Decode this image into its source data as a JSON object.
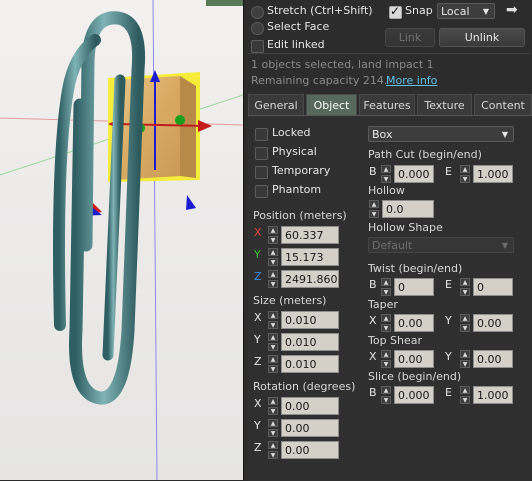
{
  "toolbar": {
    "stretch_label": "Stretch (Ctrl+Shift)",
    "select_face_label": "Select Face",
    "edit_linked_label": "Edit linked",
    "snap_label": "Snap",
    "snap_checked": true,
    "snap_mode": "Local",
    "link_label": "Link",
    "unlink_label": "Unlink",
    "arrow_icon": "arrow-right-icon"
  },
  "status": {
    "selection": "1 objects selected, land impact 1",
    "remaining": "Remaining capacity 214.",
    "more_info": "More info"
  },
  "tabs": [
    "General",
    "Object",
    "Features",
    "Texture",
    "Content"
  ],
  "active_tab": "Object",
  "object": {
    "checkboxes": [
      {
        "label": "Locked",
        "checked": false
      },
      {
        "label": "Physical",
        "checked": false
      },
      {
        "label": "Temporary",
        "checked": false
      },
      {
        "label": "Phantom",
        "checked": false
      }
    ],
    "position_label": "Position (meters)",
    "position": {
      "x": "60.337",
      "y": "15.173",
      "z": "2491.860"
    },
    "size_label": "Size (meters)",
    "size": {
      "x": "0.010",
      "y": "0.010",
      "z": "0.010"
    },
    "rotation_label": "Rotation (degrees)",
    "rotation": {
      "x": "0.00",
      "y": "0.00",
      "z": "0.00"
    },
    "axis": {
      "x": "X",
      "y": "Y",
      "z": "Z"
    },
    "shape": "Box",
    "path_cut_label": "Path Cut (begin/end)",
    "path_cut": {
      "b_label": "B",
      "b": "0.000",
      "e_label": "E",
      "e": "1.000"
    },
    "hollow_label": "Hollow",
    "hollow": "0.0",
    "hollow_shape_label": "Hollow Shape",
    "hollow_shape": "Default",
    "twist_label": "Twist (begin/end)",
    "twist": {
      "b_label": "B",
      "b": "0",
      "e_label": "E",
      "e": "0"
    },
    "taper_label": "Taper",
    "taper": {
      "x_label": "X",
      "x": "0.00",
      "y_label": "Y",
      "y": "0.00"
    },
    "top_shear_label": "Top Shear",
    "top_shear": {
      "x_label": "X",
      "x": "0.00",
      "y_label": "Y",
      "y": "0.00"
    },
    "slice_label": "Slice (begin/end)",
    "slice": {
      "b_label": "B",
      "b": "0.000",
      "e_label": "E",
      "e": "1.000"
    }
  },
  "colors": {
    "tab_active": "#56695a",
    "link": "#5fc0e8",
    "x_axis": "#e64a3a",
    "y_axis": "#38c238",
    "z_axis": "#3a8ae6"
  }
}
